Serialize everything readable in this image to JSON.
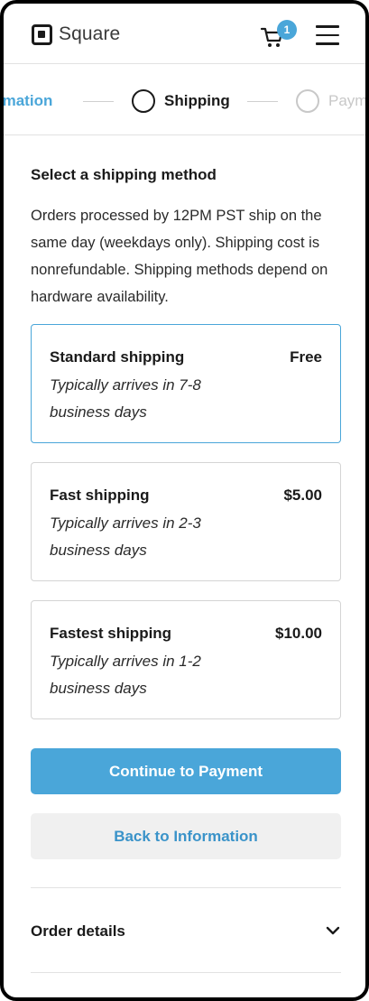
{
  "header": {
    "logo_text": "Square",
    "cart_count": "1"
  },
  "steps": {
    "previous": "rmation",
    "current": "Shipping",
    "next": "Paym"
  },
  "shipping": {
    "title": "Select a shipping method",
    "description": "Orders processed by 12PM PST ship on the same day (weekdays only). Shipping cost is nonrefundable. Shipping methods depend on hardware availability.",
    "options": [
      {
        "name": "Standard shipping",
        "price": "Free",
        "desc": "Typically arrives in 7-8 business days",
        "selected": true
      },
      {
        "name": "Fast shipping",
        "price": "$5.00",
        "desc": "Typically arrives in 2-3 business days",
        "selected": false
      },
      {
        "name": "Fastest shipping",
        "price": "$10.00",
        "desc": "Typically arrives in 1-2 business days",
        "selected": false
      }
    ]
  },
  "actions": {
    "continue_label": "Continue to Payment",
    "back_label": "Back to Information"
  },
  "order_details": {
    "label": "Order details"
  },
  "colors": {
    "accent": "#4aa6d9",
    "secondary_bg": "#f0f0f0"
  }
}
